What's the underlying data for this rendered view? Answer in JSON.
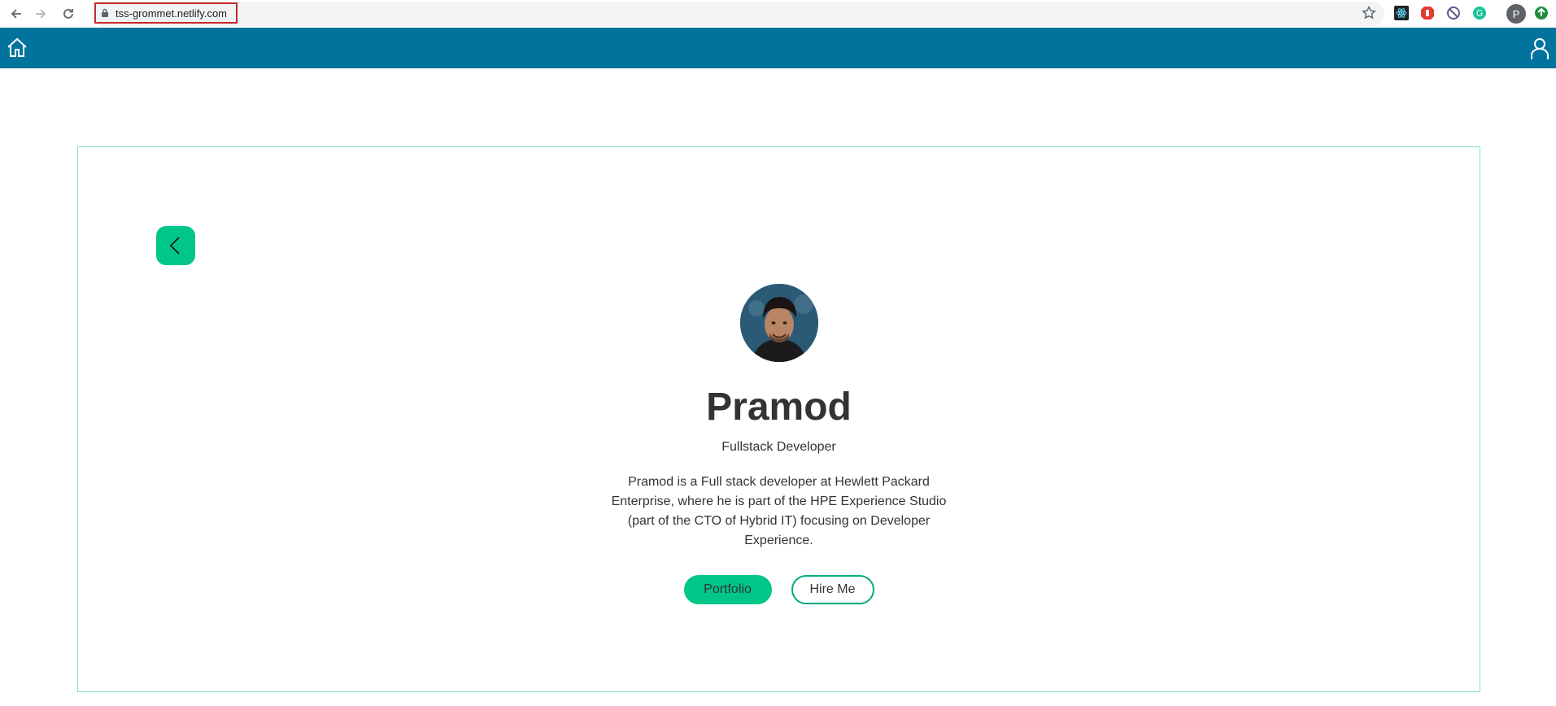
{
  "browser": {
    "url": "tss-grommet.netlify.com",
    "profile_initial": "P",
    "extensions": [
      "react-devtools-icon",
      "adblock-icon",
      "block-icon",
      "grammarly-icon",
      "update-icon"
    ]
  },
  "header": {
    "brand_color": "#01739d"
  },
  "profile": {
    "name": "Pramod",
    "role": "Fullstack Developer",
    "bio": "Pramod is a Full stack developer at Hewlett Packard Enterprise, where he is part of the HPE Experience Studio (part of the CTO of Hybrid IT) focusing on Developer Experience.",
    "primary_button": "Portfolio",
    "secondary_button": "Hire Me"
  },
  "colors": {
    "accent": "#01c68a",
    "card_border": "#7ee2b8",
    "text": "#333333"
  }
}
